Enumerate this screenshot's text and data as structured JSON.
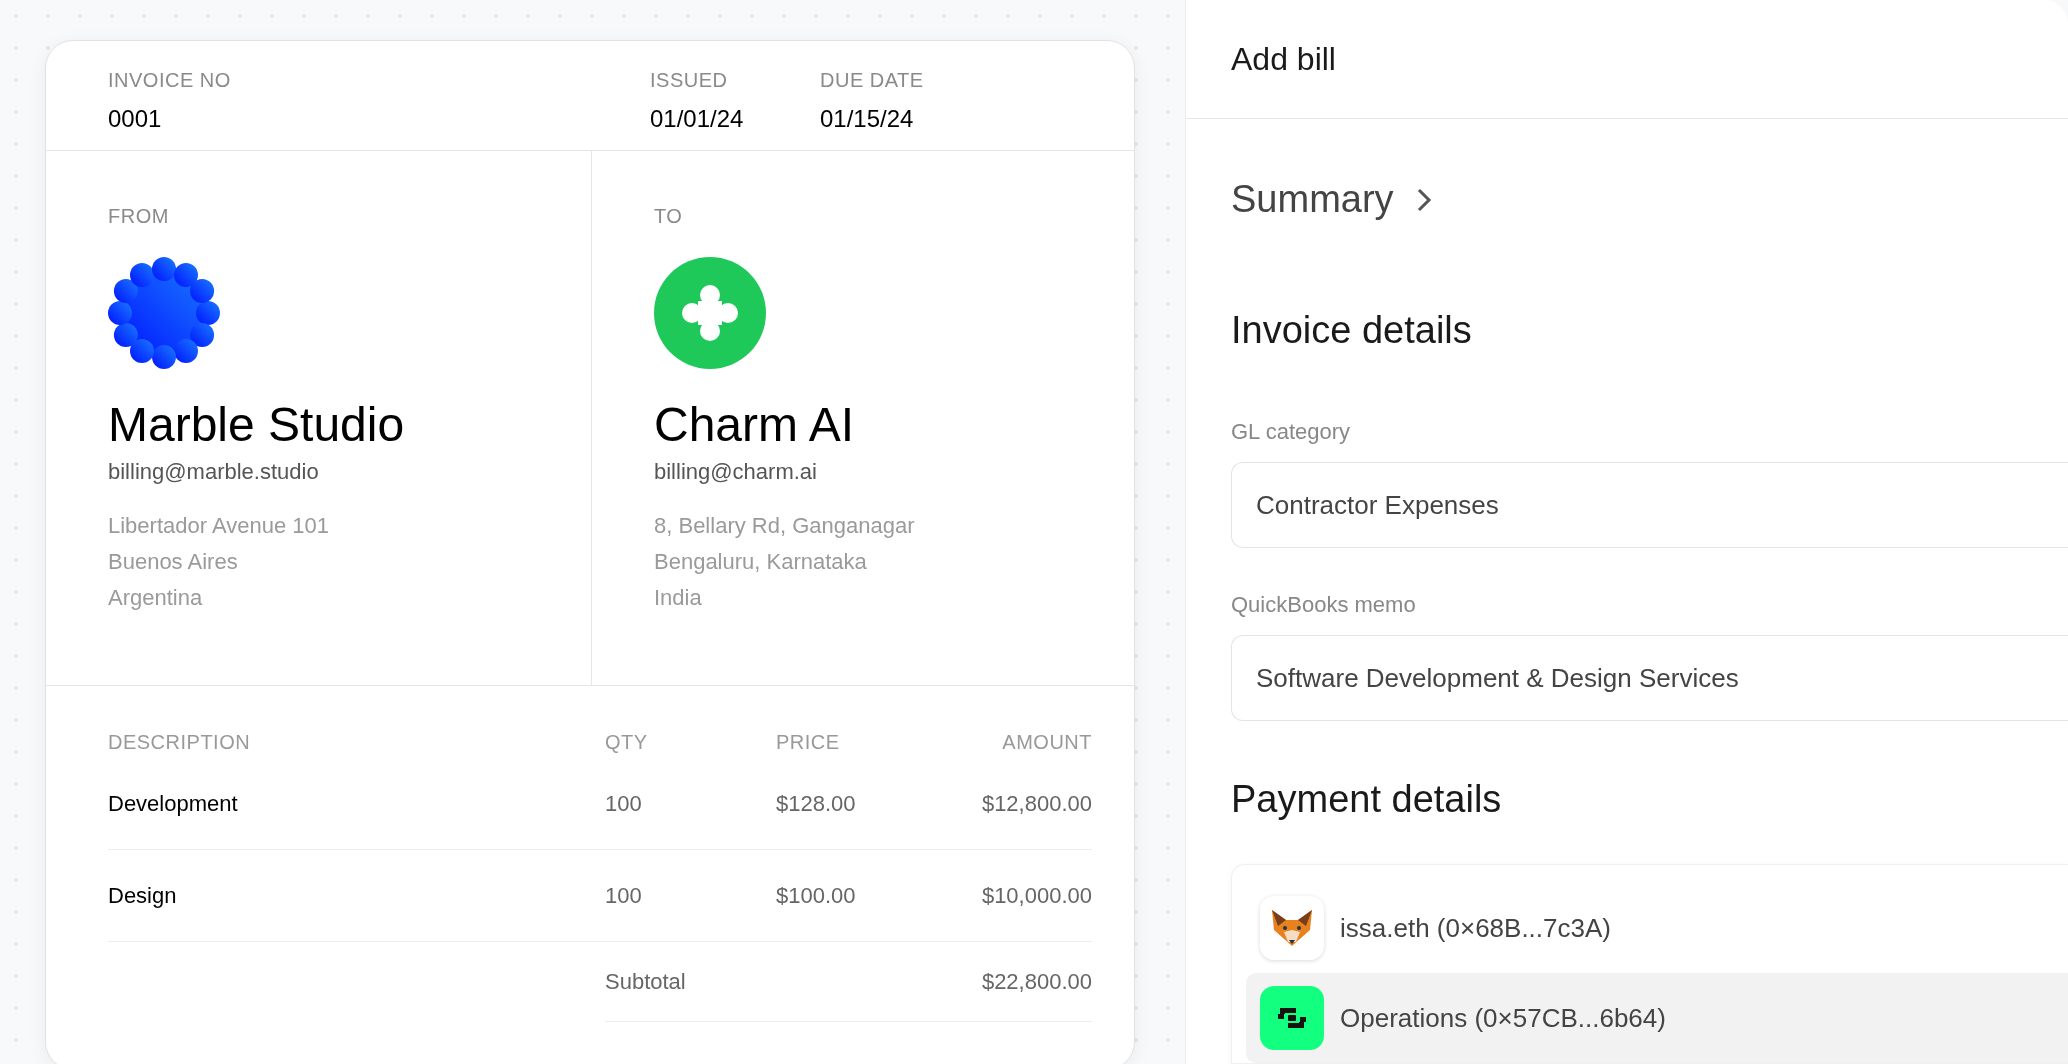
{
  "invoice": {
    "number_label": "INVOICE NO",
    "number": "0001",
    "issued_label": "ISSUED",
    "issued": "01/01/24",
    "due_label": "DUE DATE",
    "due": "01/15/24"
  },
  "parties": [
    {
      "label": "FROM",
      "kind": "badge",
      "name": "Marble Studio",
      "email": "billing@marble.studio",
      "address": [
        "Libertador Avenue 101",
        "Buenos Aires",
        "Argentina"
      ]
    },
    {
      "label": "TO",
      "kind": "clover",
      "name": "Charm AI",
      "email": "billing@charm.ai",
      "address": [
        "8, Bellary Rd, Ganganagar",
        "Bengaluru, Karnataka",
        "India"
      ]
    }
  ],
  "table": {
    "columns": [
      "DESCRIPTION",
      "QTY",
      "PRICE",
      "AMOUNT"
    ],
    "rows": [
      [
        "Development",
        "100",
        "$128.00",
        "$12,800.00"
      ],
      [
        "Design",
        "100",
        "$100.00",
        "$10,000.00"
      ]
    ],
    "subtotal_label": "Subtotal",
    "subtotal": "$22,800.00"
  },
  "panel": {
    "title": "Add bill",
    "summary": "Summary",
    "invoice_heading": "Invoice details",
    "fields": [
      {
        "label": "GL category",
        "value": "Contractor Expenses"
      },
      {
        "label": "QuickBooks memo",
        "value": "Software Development & Design Services"
      }
    ],
    "payment_heading": "Payment details",
    "wallets": [
      {
        "kind": "fox",
        "label": "issa.eth (0×68B...7c3A)",
        "selected": false
      },
      {
        "kind": "safe",
        "label": "Operations (0×57CB...6b64)",
        "selected": true
      }
    ]
  }
}
